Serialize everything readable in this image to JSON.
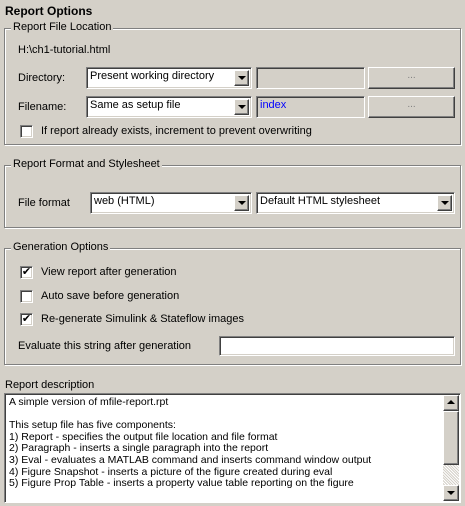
{
  "title": "Report Options",
  "file_location": {
    "legend": "Report File Location",
    "path": "H:\\ch1-tutorial.html",
    "directory_label": "Directory:",
    "directory_value": "Present working directory",
    "directory_browse": "...",
    "filename_label": "Filename:",
    "filename_value": "Same as setup file",
    "filename_text": "index",
    "filename_browse": "...",
    "increment_label": "If report already exists, increment to prevent overwriting",
    "increment_checked": false
  },
  "format": {
    "legend": "Report Format and Stylesheet",
    "file_format_label": "File format",
    "file_format_value": "web (HTML)",
    "stylesheet_value": "Default HTML stylesheet"
  },
  "generation": {
    "legend": "Generation Options",
    "view_label": "View report after generation",
    "view_checked": true,
    "autosave_label": "Auto save before generation",
    "autosave_checked": false,
    "regen_label": "Re-generate Simulink & Stateflow images",
    "regen_checked": true,
    "evaluate_label": "Evaluate this string after generation",
    "evaluate_value": ""
  },
  "description": {
    "label": "Report description",
    "lines": [
      "A simple version of mfile-report.rpt",
      "",
      "This setup file has five components:",
      "1) Report - specifies the output file location and file format",
      "  2) Paragraph - inserts a single paragraph into the report",
      "  3) Eval - evaluates a MATLAB command and inserts command window output",
      "  4) Figure Snapshot - inserts a picture of the figure created during eval",
      "  5) Figure Prop Table - inserts a property value table reporting on the figure"
    ]
  },
  "icons": {
    "check": "✔"
  }
}
